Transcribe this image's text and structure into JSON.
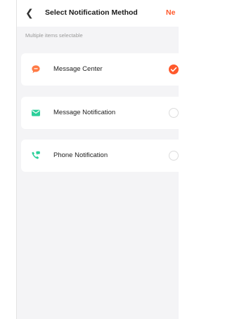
{
  "header": {
    "back_icon": "chevron-left-icon",
    "title": "Select Notification Method",
    "next_label": "Ne"
  },
  "hint": "Multiple items selectable",
  "options": [
    {
      "label": "Message Center",
      "icon": "chat-bubble-icon",
      "color": "#ff7a45",
      "selected": true
    },
    {
      "label": "Message Notification",
      "icon": "envelope-icon",
      "color": "#2ccf9a",
      "selected": false
    },
    {
      "label": "Phone Notification",
      "icon": "phone-icon",
      "color": "#2ccf9a",
      "selected": false
    }
  ],
  "accent": "#ff592c"
}
